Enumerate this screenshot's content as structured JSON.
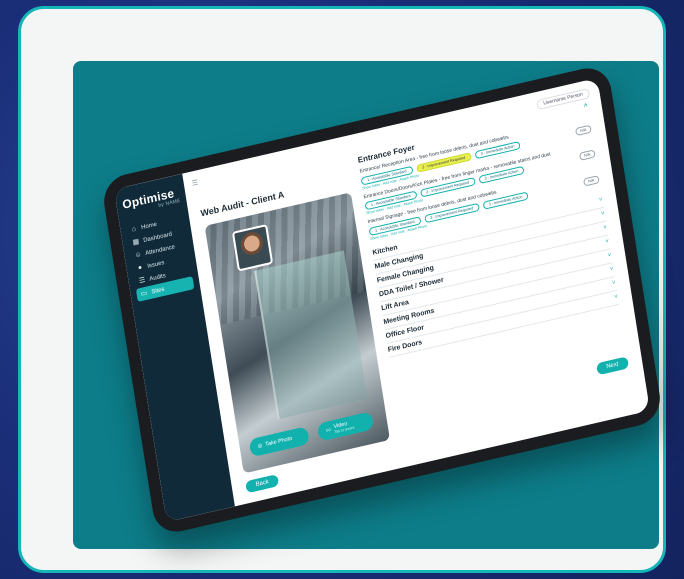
{
  "app": {
    "logo": "Optimise",
    "logo_sub": "by NAME"
  },
  "sidebar": {
    "items": [
      {
        "label": "Home",
        "icon": "home-icon",
        "glyph": "⌂",
        "active": false
      },
      {
        "label": "Dashboard",
        "icon": "dashboard-icon",
        "glyph": "▦",
        "active": false
      },
      {
        "label": "Attendance",
        "icon": "people-icon",
        "glyph": "☺",
        "active": false
      },
      {
        "label": "Issues",
        "icon": "alert-icon",
        "glyph": "●",
        "active": false
      },
      {
        "label": "Audits",
        "icon": "list-icon",
        "glyph": "☰",
        "active": false
      },
      {
        "label": "Sites",
        "icon": "building-icon",
        "glyph": "▭",
        "active": true
      }
    ]
  },
  "header": {
    "user": "Username Person"
  },
  "audit": {
    "title": "Web Audit - Client A"
  },
  "photo_panel": {
    "take_photo": "Take Photo",
    "video": "Video",
    "video_sub": "Tap to record"
  },
  "checklist": {
    "section_title": "Entrance Foyer",
    "questions": [
      {
        "text": "Entrance/ Reception Area - free from loose debris, dust and cobwebs",
        "options": [
          "1 - Acceptable Standard",
          "2 - Improvement Required",
          "3 - Immediate Action"
        ],
        "selected": 1,
        "na": "N/A",
        "links": "Show notes · Add note · Attach Photo"
      },
      {
        "text": "Entrance Doors/Doors/Kick Plates - free from finger marks - removable stains and dust",
        "options": [
          "1 - Acceptable Standard",
          "2 - Improvement Required",
          "3 - Immediate Action"
        ],
        "selected": -1,
        "na": "N/A",
        "links": "Show notes · Add note · Attach Photo"
      },
      {
        "text": "Internal Signage - free from loose debris, dust and cobwebs",
        "options": [
          "1 - Acceptable Standard",
          "2 - Improvement Required",
          "3 - Immediate Action"
        ],
        "selected": -1,
        "na": "N/A",
        "links": "Show notes · Add note · Attach Photo"
      }
    ],
    "areas": [
      "Kitchen",
      "Male Changing",
      "Female Changing",
      "DDA Toilet / Shower",
      "Lift Area",
      "Meeting Rooms",
      "Office Floor",
      "Fire Doors"
    ]
  },
  "buttons": {
    "back": "Back",
    "next": "Next"
  },
  "colors": {
    "accent": "#12b1ae",
    "sidebar": "#102a3a",
    "highlight": "#e7f050",
    "panel": "#0d7d89",
    "frame": "#14b6b8"
  }
}
